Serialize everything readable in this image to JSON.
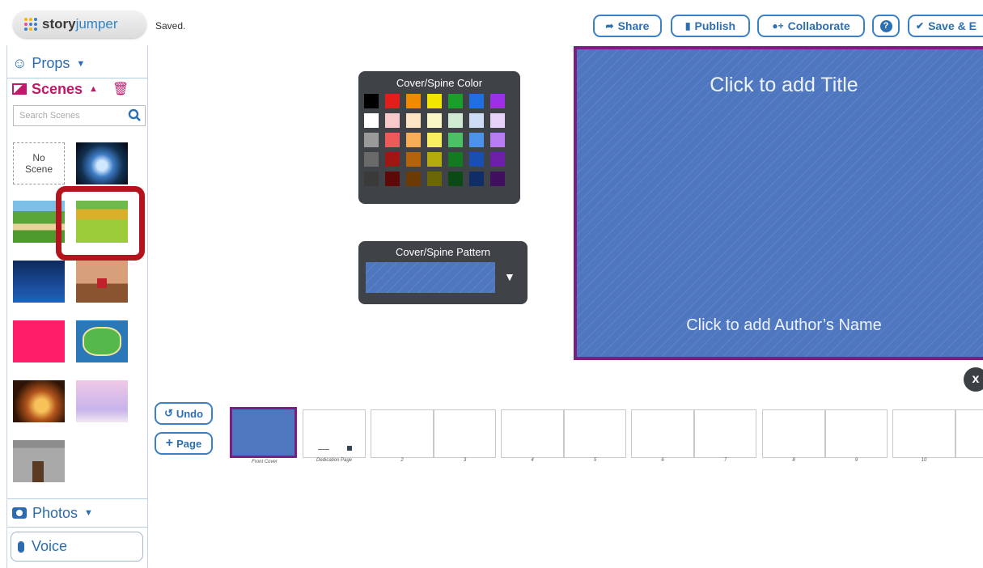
{
  "header": {
    "logo_prefix": "story",
    "logo_suffix": "jumper",
    "status": "Saved.",
    "buttons": {
      "share": "Share",
      "publish": "Publish",
      "collaborate": "Collaborate",
      "help": "?",
      "save_exit": "Save & E"
    }
  },
  "sidebar": {
    "props_label": "Props",
    "scenes_label": "Scenes",
    "search_placeholder": "Search Scenes",
    "no_scene_label": "No Scene",
    "photos_label": "Photos",
    "voice_label": "Voice"
  },
  "panels": {
    "color_title": "Cover/Spine Color",
    "pattern_title": "Cover/Spine Pattern",
    "colors": [
      [
        "#000000",
        "#e31c1c",
        "#f08a00",
        "#f2e600",
        "#1b9e2a",
        "#1f6fe0",
        "#9b30e8"
      ],
      [
        "#ffffff",
        "#f8c9c9",
        "#fde4c4",
        "#fbf6c6",
        "#cfe9d2",
        "#cfdcf6",
        "#e6d2f8"
      ],
      [
        "#9a9a9a",
        "#ee5a5a",
        "#f6ad55",
        "#f7ef5e",
        "#4cc064",
        "#4c92ea",
        "#b77df0"
      ],
      [
        "#6a6a6a",
        "#a11515",
        "#b5620c",
        "#b3ac0c",
        "#137a22",
        "#184fb0",
        "#6d1fa8"
      ],
      [
        "#3a3a3a",
        "#5e0909",
        "#6b3a05",
        "#6b6606",
        "#0b4a14",
        "#0f2e68",
        "#40105f"
      ]
    ]
  },
  "cover": {
    "title_placeholder": "Click to add Title",
    "author_placeholder": "Click to add Author’s Name",
    "color": "#4f77c0"
  },
  "controls": {
    "undo_label": "Undo",
    "page_label": "Page",
    "close_icon": "x"
  },
  "pages": [
    {
      "label": "Front Cover"
    },
    {
      "label": "Dedication Page"
    },
    {
      "label": "2"
    },
    {
      "label": "3"
    },
    {
      "label": "4"
    },
    {
      "label": "5"
    },
    {
      "label": "6"
    },
    {
      "label": "7"
    },
    {
      "label": "8"
    },
    {
      "label": "9"
    },
    {
      "label": "10"
    },
    {
      "label": ""
    }
  ]
}
